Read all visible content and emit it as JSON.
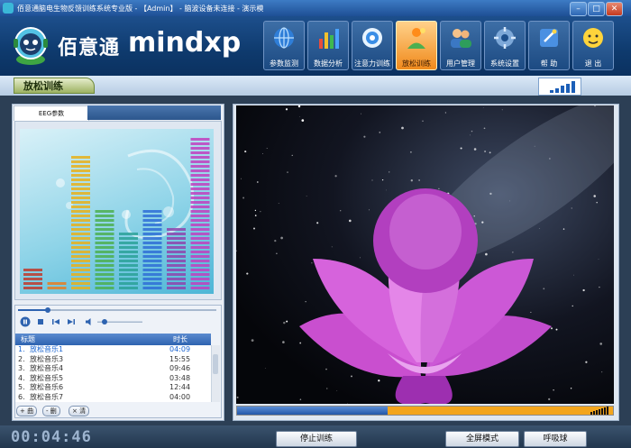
{
  "window": {
    "title": "佰意通脑电生物反馈训练系统专业版 - 【Admin】 - 脑波设备未连接 - 演示模",
    "minimize": "–",
    "maximize": "□",
    "close": "✕"
  },
  "brand": {
    "name_cn": "佰意通",
    "name_en": "mindxp"
  },
  "nav": [
    {
      "label": "参数监测",
      "icon": "globe-icon"
    },
    {
      "label": "数据分析",
      "icon": "bar-chart-icon"
    },
    {
      "label": "注意力训练",
      "icon": "target-icon"
    },
    {
      "label": "放松训练",
      "icon": "relax-icon",
      "active": true
    },
    {
      "label": "用户管理",
      "icon": "users-icon"
    },
    {
      "label": "系统设置",
      "icon": "settings-icon"
    },
    {
      "label": "帮 助",
      "icon": "help-icon"
    },
    {
      "label": "退 出",
      "icon": "exit-icon"
    }
  ],
  "section": {
    "title": "放松训练",
    "signal_bars": 5
  },
  "eeg": {
    "tab_label": "EEG参数",
    "bar_levels": [
      0.16,
      0.06,
      0.88,
      0.52,
      0.38,
      0.52,
      0.4,
      1.0
    ]
  },
  "player": {
    "columns": {
      "title": "标题",
      "duration": "时长"
    },
    "tracks": [
      {
        "num": "1.",
        "name": "放松音乐1",
        "duration": "04:09",
        "active": true
      },
      {
        "num": "2.",
        "name": "放松音乐3",
        "duration": "15:55"
      },
      {
        "num": "3.",
        "name": "放松音乐4",
        "duration": "09:46"
      },
      {
        "num": "4.",
        "name": "放松音乐5",
        "duration": "03:48"
      },
      {
        "num": "5.",
        "name": "放松音乐6",
        "duration": "12:44"
      },
      {
        "num": "6.",
        "name": "放松音乐7",
        "duration": "04:00"
      }
    ],
    "buttons": {
      "add": "+ 曲",
      "remove": "- 删",
      "clear": "× 清"
    },
    "seek_fraction": 0.15,
    "volume_fraction": 0.1
  },
  "video": {
    "progress_fraction": 0.4
  },
  "footer": {
    "timer": "00:04:46",
    "stop_button": "停止训练",
    "fullscreen_button": "全屏模式",
    "breathe_button": "呼吸球"
  },
  "colors": {
    "active_nav": "#f08a1c",
    "progress_fill": "#2257a8",
    "progress_track": "#f3a51d",
    "active_track": "#1a64d0"
  }
}
